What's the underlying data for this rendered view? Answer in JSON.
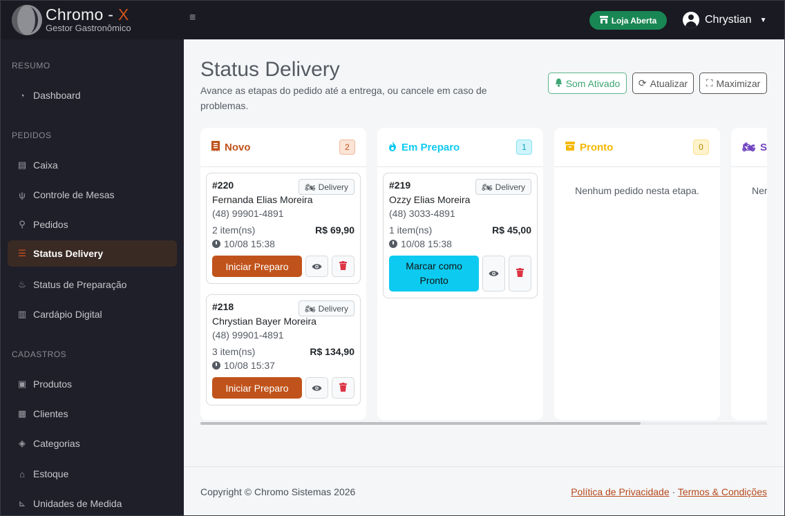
{
  "brand": {
    "name": "Chromo -",
    "name_accent": "X",
    "tagline": "Gestor Gastronômico"
  },
  "topbar": {
    "store_status": "Loja Aberta",
    "user_name": "Chrystian"
  },
  "sidebar": {
    "sections": [
      {
        "title": "RESUMO"
      },
      {
        "title": "PEDIDOS"
      },
      {
        "title": "CADASTROS"
      }
    ],
    "items": [
      {
        "label": "Dashboard",
        "icon": "dashboard-icon"
      },
      {
        "label": "Caixa",
        "icon": "cash-register-icon"
      },
      {
        "label": "Controle de Mesas",
        "icon": "utensils-icon"
      },
      {
        "label": "Pedidos",
        "icon": "motorcycle-icon"
      },
      {
        "label": "Status Delivery",
        "icon": "list-check-icon",
        "active": true
      },
      {
        "label": "Status de Preparação",
        "icon": "chef-icon"
      },
      {
        "label": "Cardápio Digital",
        "icon": "book-icon"
      },
      {
        "label": "Produtos",
        "icon": "box-icon"
      },
      {
        "label": "Clientes",
        "icon": "address-book-icon"
      },
      {
        "label": "Categorias",
        "icon": "tags-icon"
      },
      {
        "label": "Estoque",
        "icon": "warehouse-icon"
      },
      {
        "label": "Unidades de Medida",
        "icon": "ruler-icon"
      }
    ]
  },
  "page": {
    "title": "Status Delivery",
    "subtitle": "Avance as etapas do pedido até a entrega, ou cancele em caso de problemas.",
    "buttons": {
      "sound": "Som Ativado",
      "refresh": "Atualizar",
      "maximize": "Maximizar"
    }
  },
  "columns": [
    {
      "title": "Novo",
      "count": "2",
      "color": "#c0531b",
      "badge_bg": "#fbe3d6",
      "badge_color": "#c0531b"
    },
    {
      "title": "Em Preparo",
      "count": "1",
      "color": "#0dcaf0",
      "badge_bg": "#cff4fc",
      "badge_color": "#0aa2c0"
    },
    {
      "title": "Pronto",
      "count": "0",
      "color": "#f5b800",
      "badge_bg": "#fff3cd",
      "badge_color": "#b38600",
      "empty": "Nenhum pedido nesta etapa."
    },
    {
      "title": "S",
      "color": "#6f42c1",
      "empty": "Ner"
    }
  ],
  "orders": {
    "novo": [
      {
        "number": "#220",
        "tag": "Delivery",
        "name": "Fernanda Elias Moreira",
        "phone": "(48) 99901-4891",
        "items": "2 item(ns)",
        "total": "R$ 69,90",
        "time": "10/08 15:38",
        "action": "Iniciar Preparo"
      },
      {
        "number": "#218",
        "tag": "Delivery",
        "name": "Chrystian Bayer Moreira",
        "phone": "(48) 99901-4891",
        "items": "3 item(ns)",
        "total": "R$ 134,90",
        "time": "10/08 15:37",
        "action": "Iniciar Preparo"
      }
    ],
    "preparo": [
      {
        "number": "#219",
        "tag": "Delivery",
        "name": "Ozzy Elias Moreira",
        "phone": "(48) 3033-4891",
        "items": "1 item(ns)",
        "total": "R$ 45,00",
        "time": "10/08 15:38",
        "action": "Marcar como Pronto"
      }
    ]
  },
  "footer": {
    "copyright": "Copyright © Chromo Sistemas 2026",
    "privacy": "Política de Privacidade",
    "separator": "·",
    "terms": "Termos & Condições"
  },
  "colors": {
    "accent": "#c0531b",
    "success": "#198754",
    "danger": "#dc3545",
    "info": "#0dcaf0"
  }
}
